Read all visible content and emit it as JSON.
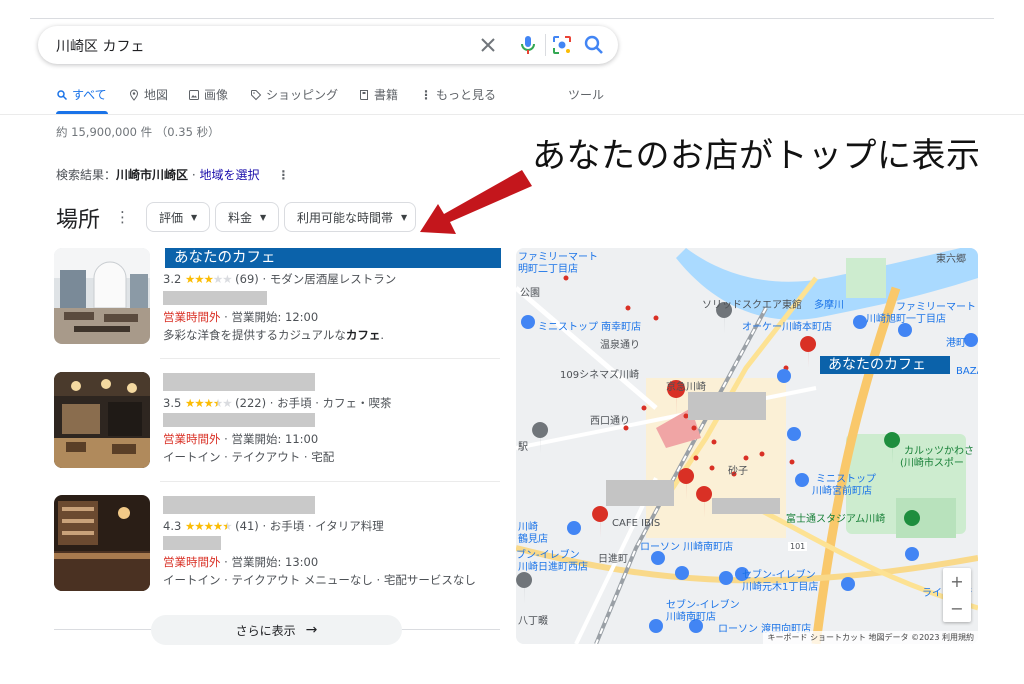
{
  "search": {
    "query": "川崎区 カフェ"
  },
  "tabs": [
    {
      "label": "すべて",
      "icon": "search-icon"
    },
    {
      "label": "地図",
      "icon": "map-pin-icon"
    },
    {
      "label": "画像",
      "icon": "image-icon"
    },
    {
      "label": "ショッピング",
      "icon": "tag-icon"
    },
    {
      "label": "書籍",
      "icon": "book-icon"
    },
    {
      "label": "もっと見る",
      "icon": "more-vert-icon"
    },
    {
      "label": "ツール",
      "icon": ""
    }
  ],
  "result_stats": "約 15,900,000 件 （0.35 秒）",
  "location": {
    "prefix": "検索結果：",
    "place": "川崎市川崎区",
    "dot": " · ",
    "link": "地域を選択"
  },
  "annotation": "あなたのお店がトップに表示",
  "places": {
    "heading": "場所",
    "filters": [
      "評価",
      "料金",
      "利用可能な時間帯"
    ],
    "items": [
      {
        "name": "あなたのカフェ",
        "rating": "3.2",
        "stars": 3,
        "reviews": "(69)",
        "category": "· モダン居酒屋レストラン",
        "status": "営業時間外",
        "open": " · 営業開始: 12:00",
        "desc_pre": "多彩な洋食を提供するカジュアルな",
        "desc_bold": "カフェ",
        "desc_post": "."
      },
      {
        "rating": "3.5",
        "stars": 3.5,
        "reviews": "(222)",
        "category": "· お手頃 · カフェ・喫茶",
        "status": "営業時間外",
        "open": " · 営業開始: 11:00",
        "desc": "イートイン · テイクアウト · 宅配"
      },
      {
        "rating": "4.3",
        "stars": 4.5,
        "reviews": "(41)",
        "category": "· お手頃 · イタリア料理",
        "status": "営業時間外",
        "open": " · 営業開始: 13:00",
        "desc": "イートイン · テイクアウト メニューなし · 宅配サービスなし"
      }
    ],
    "more_label": "さらに表示"
  },
  "map": {
    "highlight": "あなたのカフェ",
    "labels": [
      "ファミリーマート",
      "明町二丁目店",
      "ソリッドスクエア東館",
      "多摩川",
      "東六郷",
      "ファミリーマート",
      "川崎旭町一丁目店",
      "ミニストップ 南幸町店",
      "オーケー川崎本町店",
      "温泉通り",
      "港町",
      "109シネマズ川崎",
      "京急川崎",
      "BAZA",
      "西口通り",
      "カルッツかわさ",
      "(川崎市スポー",
      "ミニストップ",
      "川崎宮前町店",
      "砂子",
      "CAFE IBIS",
      "富士通スタジアム川崎",
      "川崎",
      "鶴見店",
      "ブン-イレブン",
      "日進町",
      "ローソン 川崎南町店",
      "川崎日進町西店",
      "セブン-イレブン",
      "川崎元木1丁目店",
      "ライフ川崎",
      "セブン-イレブン",
      "川崎南町店",
      "八丁畷",
      "ローソン 渡田向町店",
      "公園",
      "駅",
      "101"
    ],
    "zoom_in": "+",
    "zoom_out": "−",
    "attribution": "キーボード ショートカット   地図データ ©2023   利用規約"
  },
  "colors": {
    "accent": "#1a73e8",
    "highlight": "#0b62aa",
    "closed": "#d93025",
    "star": "#fbbc04",
    "arrow": "#c4161c"
  }
}
